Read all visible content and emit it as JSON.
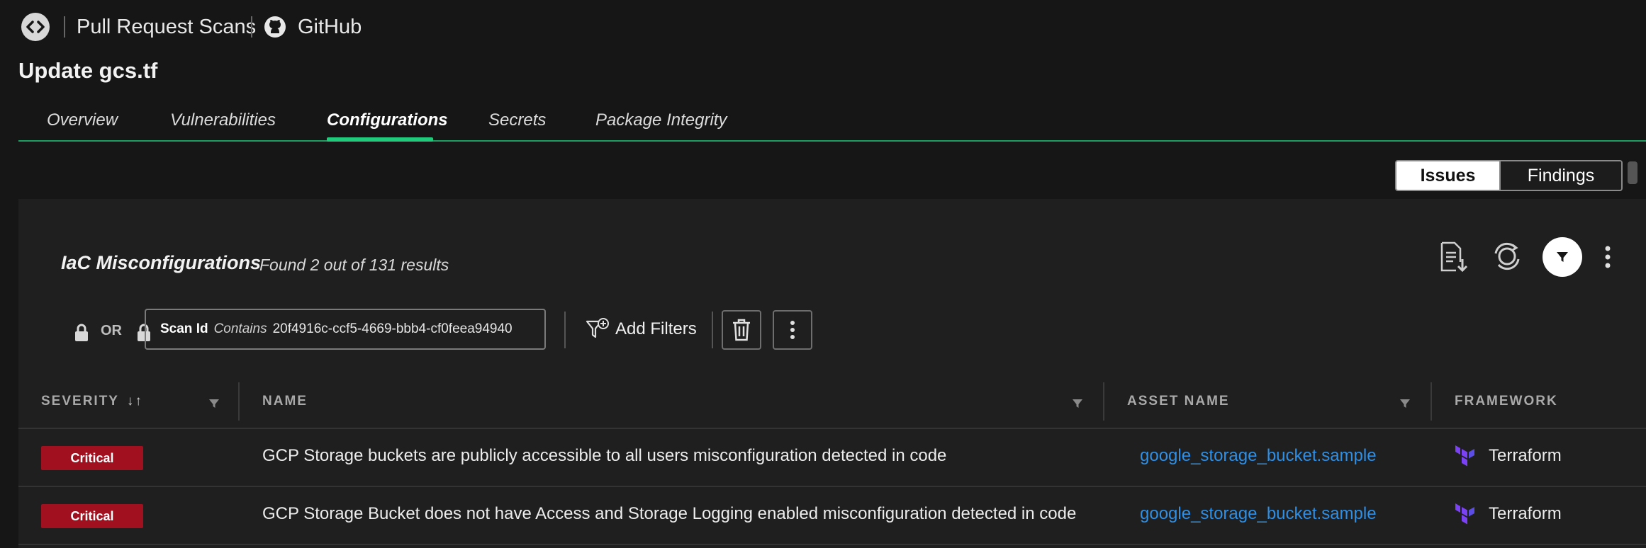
{
  "header": {
    "breadcrumb_section": "Pull Request Scans",
    "breadcrumb_source": "GitHub"
  },
  "page": {
    "title": "Update gcs.tf"
  },
  "tabs": [
    {
      "label": "Overview"
    },
    {
      "label": "Vulnerabilities"
    },
    {
      "label": "Configurations",
      "active": true
    },
    {
      "label": "Secrets"
    },
    {
      "label": "Package Integrity"
    }
  ],
  "view_toggle": {
    "issues": "Issues",
    "findings": "Findings",
    "selected": "Issues"
  },
  "panel": {
    "title": "IaC Misconfigurations",
    "result_count": "Found 2 out of 131 results"
  },
  "filters": {
    "operator": "OR",
    "chip": {
      "field": "Scan Id",
      "op": "Contains",
      "value": "20f4916c-ccf5-4669-bbb4-cf0feea94940"
    },
    "add_label": "Add Filters"
  },
  "table": {
    "columns": [
      "SEVERITY",
      "NAME",
      "ASSET NAME",
      "FRAMEWORK"
    ],
    "sort_indicator": "↓↑",
    "rows": [
      {
        "severity": "Critical",
        "name": "GCP Storage buckets are publicly accessible to all users misconfiguration detected in code",
        "asset": "google_storage_bucket.sample",
        "framework": "Terraform"
      },
      {
        "severity": "Critical",
        "name": "GCP Storage Bucket does not have Access and Storage Logging enabled misconfiguration detected in code",
        "asset": "google_storage_bucket.sample",
        "framework": "Terraform"
      }
    ]
  },
  "colors": {
    "accent": "#21c97a",
    "critical": "#a0101e",
    "link": "#2d8fe6",
    "terraform": "#7b42f5"
  }
}
